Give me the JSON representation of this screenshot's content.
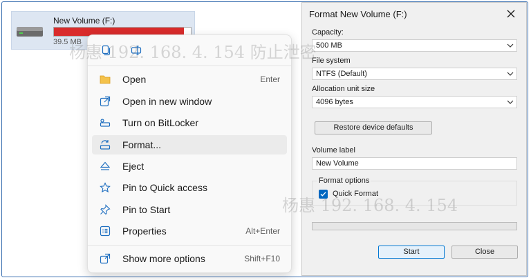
{
  "drive": {
    "name": "New Volume (F:)",
    "size": "39.5 MB",
    "used_fraction": 0.95,
    "bar_color": "#d92b2b"
  },
  "menu": {
    "top_actions": [
      {
        "icon": "copy-icon"
      },
      {
        "icon": "rename-icon"
      }
    ],
    "items": [
      {
        "label": "Open",
        "shortcut": "Enter",
        "icon": "folder-icon"
      },
      {
        "label": "Open in new window",
        "shortcut": "",
        "icon": "open-new-window-icon"
      },
      {
        "label": "Turn on BitLocker",
        "shortcut": "",
        "icon": "bitlocker-key-icon"
      },
      {
        "label": "Format...",
        "shortcut": "",
        "icon": "format-drive-icon"
      },
      {
        "label": "Eject",
        "shortcut": "",
        "icon": "eject-icon"
      },
      {
        "label": "Pin to Quick access",
        "shortcut": "",
        "icon": "star-icon"
      },
      {
        "label": "Pin to Start",
        "shortcut": "",
        "icon": "pin-icon"
      },
      {
        "label": "Properties",
        "shortcut": "Alt+Enter",
        "icon": "properties-icon"
      },
      {
        "label": "Show more options",
        "shortcut": "Shift+F10",
        "icon": "more-options-icon"
      }
    ],
    "hovered_item": "Format..."
  },
  "dialog": {
    "title": "Format New Volume (F:)",
    "capacity_label": "Capacity:",
    "capacity_value": "500 MB",
    "fs_label": "File system",
    "fs_value": "NTFS (Default)",
    "alloc_label": "Allocation unit size",
    "alloc_value": "4096 bytes",
    "restore_button": "Restore device defaults",
    "volume_label_label": "Volume label",
    "volume_label_value": "New Volume",
    "format_options_title": "Format options",
    "quick_format_label": "Quick Format",
    "quick_format_checked": true,
    "progress": 0,
    "start_button": "Start",
    "close_button": "Close"
  },
  "watermark": "杨惠 192. 168. 4. 154 防止泄密",
  "watermark_lower": "杨惠 192. 168. 4. 154",
  "colors": {
    "accent": "#0067c0",
    "drive_bar": "#d92b2b"
  }
}
